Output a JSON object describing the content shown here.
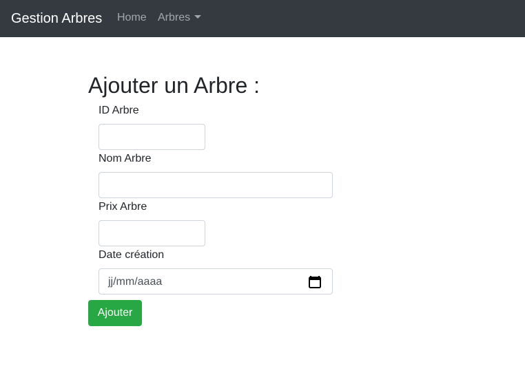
{
  "navbar": {
    "brand": "Gestion Arbres",
    "links": [
      {
        "label": "Home"
      },
      {
        "label": "Arbres",
        "icon": "caret-down-icon"
      }
    ],
    "background": "#343a40"
  },
  "form": {
    "title": "Ajouter un Arbre :",
    "fields": [
      {
        "label": "ID Arbre",
        "value": ""
      },
      {
        "label": "Nom Arbre",
        "value": ""
      },
      {
        "label": "Prix Arbre",
        "value": ""
      },
      {
        "label": "Date création",
        "placeholder": "jj/mm/aaaa",
        "icon": "calendar-icon"
      }
    ],
    "submit_label": "Ajouter",
    "submit_color": "#28a745"
  }
}
